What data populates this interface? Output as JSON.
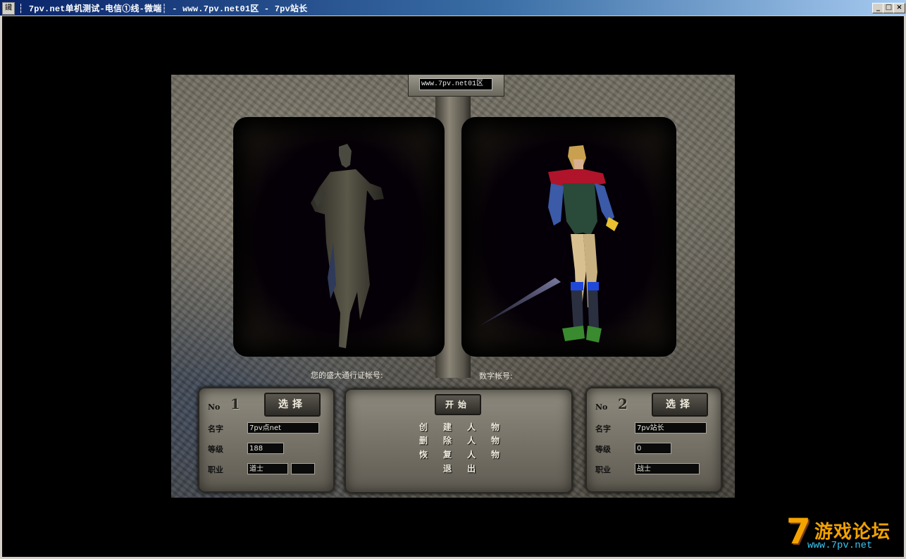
{
  "window": {
    "title": "7pv.net单机测试-电信①线-微端┆ - www.7pv.net01区 - 7pv站长",
    "icon_glyph": "鑶",
    "separator_glyph": "┆",
    "min_glyph": "_",
    "max_glyph": "□",
    "close_glyph": "×"
  },
  "server": {
    "name": "www.7pv.net01区"
  },
  "account": {
    "pass_label": "您的盛大通行证帐号:",
    "digital_label": "数字帐号:"
  },
  "slot1": {
    "no_label": "No",
    "no_value": "1",
    "select_label": "选择",
    "name_label": "名字",
    "name_value": "7pv点net",
    "level_label": "等级",
    "level_value": "188",
    "job_label": "职业",
    "job_value": "道士"
  },
  "slot2": {
    "no_label": "No",
    "no_value": "2",
    "select_label": "选择",
    "name_label": "名字",
    "name_value": "7pv站长",
    "level_label": "等级",
    "level_value": "0",
    "job_label": "职业",
    "job_value": "战士"
  },
  "menu": {
    "start": "开始",
    "create": [
      "创",
      "建",
      "人",
      "物"
    ],
    "delete": [
      "删",
      "除",
      "人",
      "物"
    ],
    "restore": [
      "恢",
      "复",
      "人",
      "物"
    ],
    "exit": [
      "退",
      "出"
    ]
  },
  "watermark": {
    "seven": "7",
    "cn_text": "游戏论坛",
    "url": "www.7pv.net"
  },
  "colors": {
    "title_bar": "#0a246a",
    "stone": "#6c685d",
    "watermark_orange": "#f5a300",
    "watermark_blue": "#39c7f2"
  }
}
